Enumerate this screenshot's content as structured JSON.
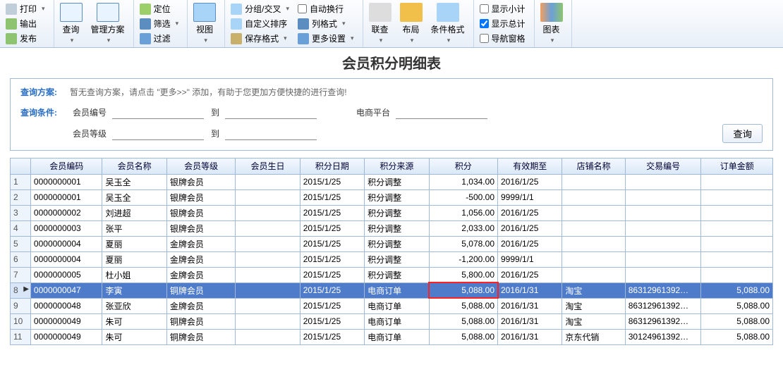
{
  "ribbon": {
    "g1": {
      "print": "打印",
      "export": "输出",
      "publish": "发布"
    },
    "g2": {
      "search": "查询",
      "manage": "管理方案"
    },
    "g3": {
      "locate": "定位",
      "filter": "筛选",
      "filter2": "过滤"
    },
    "g4": {
      "view": "视图"
    },
    "g5": {
      "group": "分组/交叉",
      "sort": "自定义排序",
      "save": "保存格式"
    },
    "g6": {
      "auto": "自动换行",
      "rowfmt": "列格式",
      "more": "更多设置"
    },
    "g7": {
      "link": "联查",
      "layout": "布局",
      "cond": "条件格式"
    },
    "g8": {
      "subtotal": "显示小计",
      "total": "显示总计",
      "nav": "导航窗格"
    },
    "g9": {
      "chart": "图表"
    }
  },
  "title": "会员积分明细表",
  "query": {
    "scheme_label": "查询方案:",
    "scheme_tip": "暂无查询方案，请点击 \"更多>>\" 添加，有助于您更加方便快捷的进行查询!",
    "cond_label": "查询条件:",
    "member_no": "会员编号",
    "to": "到",
    "platform": "电商平台",
    "member_level": "会员等级",
    "btn": "查询"
  },
  "cols": [
    "会员编码",
    "会员名称",
    "会员等级",
    "会员生日",
    "积分日期",
    "积分来源",
    "积分",
    "有效期至",
    "店铺名称",
    "交易编号",
    "订单金额"
  ],
  "rows": [
    {
      "n": "1",
      "code": "0000000001",
      "name": "吴玉全",
      "lvl": "银牌会员",
      "bd": "",
      "date": "2015/1/25",
      "src": "积分调整",
      "pts": "1,034.00",
      "exp": "2016/1/25",
      "shop": "",
      "txn": "",
      "amt": ""
    },
    {
      "n": "2",
      "code": "0000000001",
      "name": "吴玉全",
      "lvl": "银牌会员",
      "bd": "",
      "date": "2015/1/25",
      "src": "积分调整",
      "pts": "-500.00",
      "exp": "9999/1/1",
      "shop": "",
      "txn": "",
      "amt": ""
    },
    {
      "n": "3",
      "code": "0000000002",
      "name": "刘进超",
      "lvl": "银牌会员",
      "bd": "",
      "date": "2015/1/25",
      "src": "积分调整",
      "pts": "1,056.00",
      "exp": "2016/1/25",
      "shop": "",
      "txn": "",
      "amt": ""
    },
    {
      "n": "4",
      "code": "0000000003",
      "name": "张平",
      "lvl": "银牌会员",
      "bd": "",
      "date": "2015/1/25",
      "src": "积分调整",
      "pts": "2,033.00",
      "exp": "2016/1/25",
      "shop": "",
      "txn": "",
      "amt": ""
    },
    {
      "n": "5",
      "code": "0000000004",
      "name": "夏丽",
      "lvl": "金牌会员",
      "bd": "",
      "date": "2015/1/25",
      "src": "积分调整",
      "pts": "5,078.00",
      "exp": "2016/1/25",
      "shop": "",
      "txn": "",
      "amt": ""
    },
    {
      "n": "6",
      "code": "0000000004",
      "name": "夏丽",
      "lvl": "金牌会员",
      "bd": "",
      "date": "2015/1/25",
      "src": "积分调整",
      "pts": "-1,200.00",
      "exp": "9999/1/1",
      "shop": "",
      "txn": "",
      "amt": ""
    },
    {
      "n": "7",
      "code": "0000000005",
      "name": "杜小姐",
      "lvl": "金牌会员",
      "bd": "",
      "date": "2015/1/25",
      "src": "积分调整",
      "pts": "5,800.00",
      "exp": "2016/1/25",
      "shop": "",
      "txn": "",
      "amt": ""
    },
    {
      "n": "8",
      "code": "0000000047",
      "name": "李寅",
      "lvl": "铜牌会员",
      "bd": "",
      "date": "2015/1/25",
      "src": "电商订单",
      "pts": "5,088.00",
      "exp": "2016/1/31",
      "shop": "淘宝",
      "txn": "86312961392…",
      "amt": "5,088.00",
      "sel": true
    },
    {
      "n": "9",
      "code": "0000000048",
      "name": "张亚欣",
      "lvl": "金牌会员",
      "bd": "",
      "date": "2015/1/25",
      "src": "电商订单",
      "pts": "5,088.00",
      "exp": "2016/1/31",
      "shop": "淘宝",
      "txn": "86312961392…",
      "amt": "5,088.00"
    },
    {
      "n": "10",
      "code": "0000000049",
      "name": "朱可",
      "lvl": "铜牌会员",
      "bd": "",
      "date": "2015/1/25",
      "src": "电商订单",
      "pts": "5,088.00",
      "exp": "2016/1/31",
      "shop": "淘宝",
      "txn": "86312961392…",
      "amt": "5,088.00"
    },
    {
      "n": "11",
      "code": "0000000049",
      "name": "朱可",
      "lvl": "铜牌会员",
      "bd": "",
      "date": "2015/1/25",
      "src": "电商订单",
      "pts": "5,088.00",
      "exp": "2016/1/31",
      "shop": "京东代销",
      "txn": "30124961392…",
      "amt": "5,088.00"
    }
  ],
  "checks": {
    "subtotal": false,
    "total": true,
    "nav": false,
    "auto": false
  }
}
